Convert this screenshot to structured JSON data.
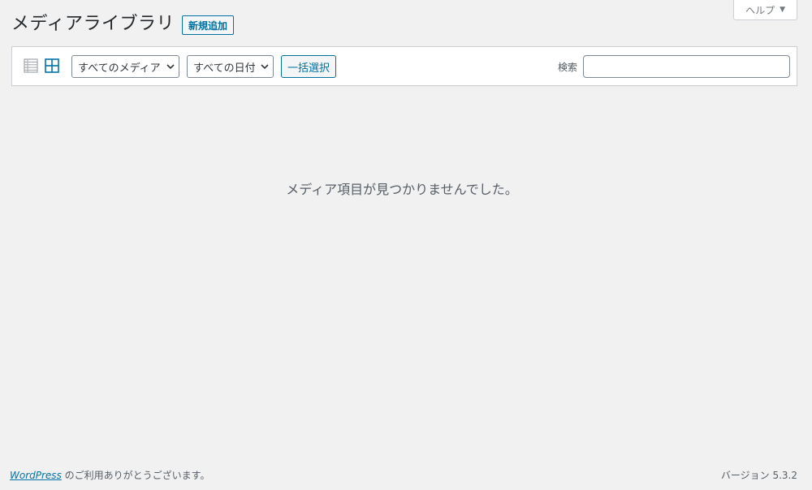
{
  "help": {
    "label": "ヘルプ",
    "caret": "▼"
  },
  "header": {
    "title": "メディアライブラリ",
    "add_new_label": "新規追加"
  },
  "toolbar": {
    "media_type_selected": "すべてのメディア",
    "date_selected": "すべての日付",
    "bulk_select_label": "一括選択",
    "search_label": "検索",
    "search_value": ""
  },
  "main": {
    "empty_message": "メディア項目が見つかりませんでした。"
  },
  "footer": {
    "link_text": "WordPress",
    "thanks_text": " のご利用ありがとうございます。",
    "version_text": "バージョン 5.3.2"
  },
  "colors": {
    "accent": "#0071a1",
    "background": "#f1f1f1",
    "link": "#0073aa"
  }
}
